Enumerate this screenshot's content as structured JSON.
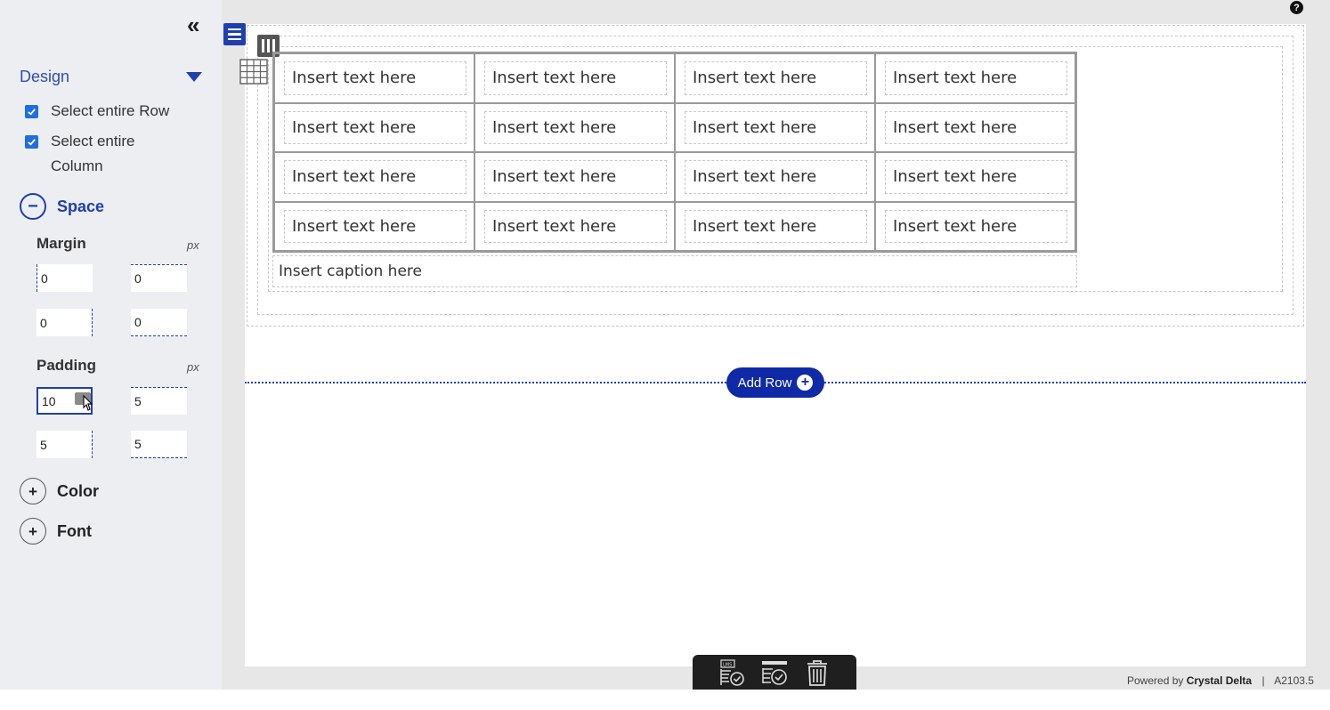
{
  "sidebar": {
    "collapse_glyph": "«",
    "design_label": "Design",
    "select_row_label": "Select entire Row",
    "select_column_label": "Select entire Column",
    "space_label": "Space",
    "margin_label": "Margin",
    "margin_unit": "px",
    "margin_values": [
      "0",
      "0",
      "0",
      "0"
    ],
    "padding_label": "Padding",
    "padding_unit": "px",
    "padding_values": [
      "10",
      "5",
      "5",
      "5"
    ],
    "color_label": "Color",
    "font_label": "Font",
    "expand_glyph": "+",
    "collapse_section_glyph": "−"
  },
  "canvas": {
    "help_glyph": "?",
    "table_rows": [
      [
        "Insert text here",
        "Insert text here",
        "Insert text here",
        "Insert text here"
      ],
      [
        "Insert text here",
        "Insert text here",
        "Insert text here",
        "Insert text here"
      ],
      [
        "Insert text here",
        "Insert text here",
        "Insert text here",
        "Insert text here"
      ],
      [
        "Insert text here",
        "Insert text here",
        "Insert text here",
        "Insert text here"
      ]
    ],
    "caption": "Insert caption here",
    "add_row_label": "Add Row",
    "add_row_glyph": "+"
  },
  "toolbar": {
    "icons": [
      "lms-check-icon",
      "save-check-icon",
      "trash-icon"
    ]
  },
  "footer": {
    "powered_by": "Powered by",
    "brand": "Crystal Delta",
    "separator": "|",
    "version": "A2103.5"
  },
  "colors": {
    "accent": "#1f3fb0",
    "add_row_bg": "#0f2aa6",
    "sidebar_bg": "#eceef1",
    "toolbar_bg": "#1f1f1f"
  }
}
